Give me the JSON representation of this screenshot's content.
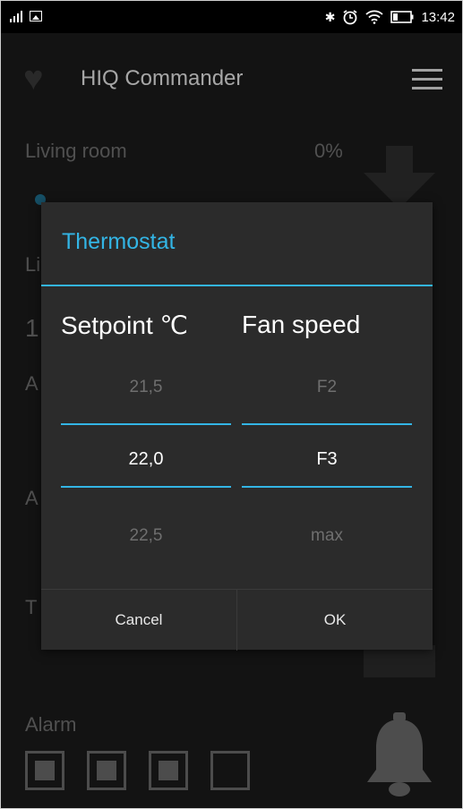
{
  "status_bar": {
    "time": "13:42",
    "left_icons": [
      "signal-icon",
      "image-icon"
    ],
    "right_icons": [
      "bluetooth-icon",
      "alarm-clock-icon",
      "wifi-icon",
      "battery-icon"
    ]
  },
  "app_bar": {
    "title": "HIQ Commander",
    "icons": [
      "heart-icon",
      "menu-icon"
    ]
  },
  "background": {
    "room_label": "Living room",
    "room_value": "0%",
    "partial_letters": [
      "Li",
      "1",
      "A",
      "A",
      "T"
    ],
    "alarm_label": "Alarm",
    "alarm_checkboxes": [
      true,
      true,
      true,
      false
    ]
  },
  "dialog": {
    "title": "Thermostat",
    "columns": [
      {
        "header": "Setpoint ℃",
        "values": [
          "21,5",
          "22,0",
          "22,5"
        ],
        "selected_index": 1
      },
      {
        "header": "Fan speed",
        "values": [
          "F2",
          "F3",
          "max"
        ],
        "selected_index": 1
      }
    ],
    "buttons": {
      "cancel": "Cancel",
      "ok": "OK"
    }
  },
  "colors": {
    "accent": "#33b5e5",
    "dialog_bg": "#2b2b2b",
    "app_bg": "#1b1b1b"
  }
}
